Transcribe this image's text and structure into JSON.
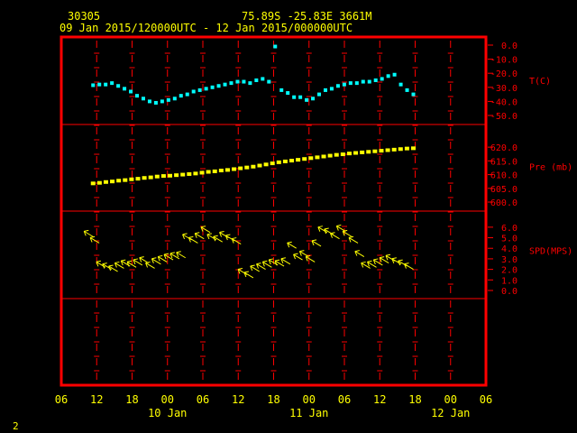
{
  "header": {
    "station": "30305",
    "location": "75.89S   -25.83E   3661M",
    "period": "09 Jan 2015/120000UTC - 12 Jan 2015/000000UTC"
  },
  "footer": {
    "page_number": "2"
  },
  "colors": {
    "frame": "#ff0000",
    "axis_text": "#ffff00",
    "right_text": "#ff0000",
    "temperature": "#00ffff",
    "pressure": "#ffff00",
    "wind": "#ffff00",
    "background": "#000000"
  },
  "chart_data": {
    "type": "scatter",
    "x_ticks": [
      "06",
      "12",
      "18",
      "00",
      "06",
      "12",
      "18",
      "00",
      "06",
      "12",
      "18",
      "00",
      "06"
    ],
    "date_labels": [
      "10 Jan",
      "11 Jan",
      "12 Jan"
    ],
    "panels": [
      {
        "name": "temperature",
        "label": "T(C)",
        "ticks": [
          "0.0",
          "-10.0",
          "-20.0",
          "-30.0",
          "-40.0",
          "-50.0"
        ],
        "ylim": [
          -50,
          0
        ],
        "values": [
          -28.5,
          -28,
          -28,
          -27,
          -29,
          -31,
          -33,
          -36,
          -38,
          -40,
          -41,
          -40,
          -39,
          -38,
          -36,
          -35,
          -33,
          -32,
          -31,
          -30,
          -29,
          -28,
          -27,
          -26,
          -26,
          -27,
          -25,
          -24,
          -26,
          -1,
          -32,
          -34,
          -37,
          -37,
          -39,
          -38,
          -35,
          -32,
          -31,
          -29,
          -28,
          -27,
          -27,
          -26,
          -26,
          -25,
          -24,
          -22,
          -21,
          -28,
          -32,
          -35
        ]
      },
      {
        "name": "pressure",
        "label": "Pre (mb)",
        "ticks": [
          "620.0",
          "615.0",
          "610.0",
          "605.0",
          "600.0"
        ],
        "ylim": [
          600,
          623
        ],
        "values": [
          606.8,
          607.0,
          607.3,
          607.5,
          607.8,
          608.0,
          608.3,
          608.5,
          608.8,
          609.0,
          609.3,
          609.5,
          609.6,
          609.8,
          610.0,
          610.2,
          610.4,
          610.7,
          611.0,
          611.2,
          611.5,
          611.7,
          612.0,
          612.3,
          612.6,
          612.9,
          613.3,
          613.7,
          614.1,
          614.5,
          614.8,
          615.1,
          615.4,
          615.7,
          616.0,
          616.3,
          616.6,
          616.9,
          617.2,
          617.4,
          617.7,
          617.9,
          618.1,
          618.3,
          618.5,
          618.7,
          618.9,
          619.1,
          619.3,
          619.5,
          619.6
        ]
      },
      {
        "name": "wind_speed",
        "label": "SPD(MPS)",
        "ticks": [
          "6.0",
          "5.0",
          "4.0",
          "3.0",
          "2.0",
          "1.0",
          "0.0"
        ],
        "ylim": [
          0,
          6.5
        ],
        "values": [
          5.1,
          4.5,
          2.2,
          2.0,
          1.8,
          2.1,
          2.3,
          2.2,
          2.4,
          2.6,
          2.1,
          2.5,
          2.7,
          2.9,
          3.0,
          3.1,
          4.8,
          4.5,
          4.9,
          5.5,
          4.8,
          4.6,
          5.0,
          4.7,
          4.4,
          1.5,
          1.2,
          1.8,
          2.0,
          2.2,
          2.4,
          2.3,
          2.5,
          4.0,
          2.9,
          3.2,
          2.7,
          4.2,
          5.5,
          5.3,
          4.9,
          5.6,
          5.1,
          4.5,
          3.2,
          2.1,
          2.2,
          2.4,
          2.6,
          2.8,
          2.5,
          2.3,
          2.0
        ]
      }
    ]
  }
}
